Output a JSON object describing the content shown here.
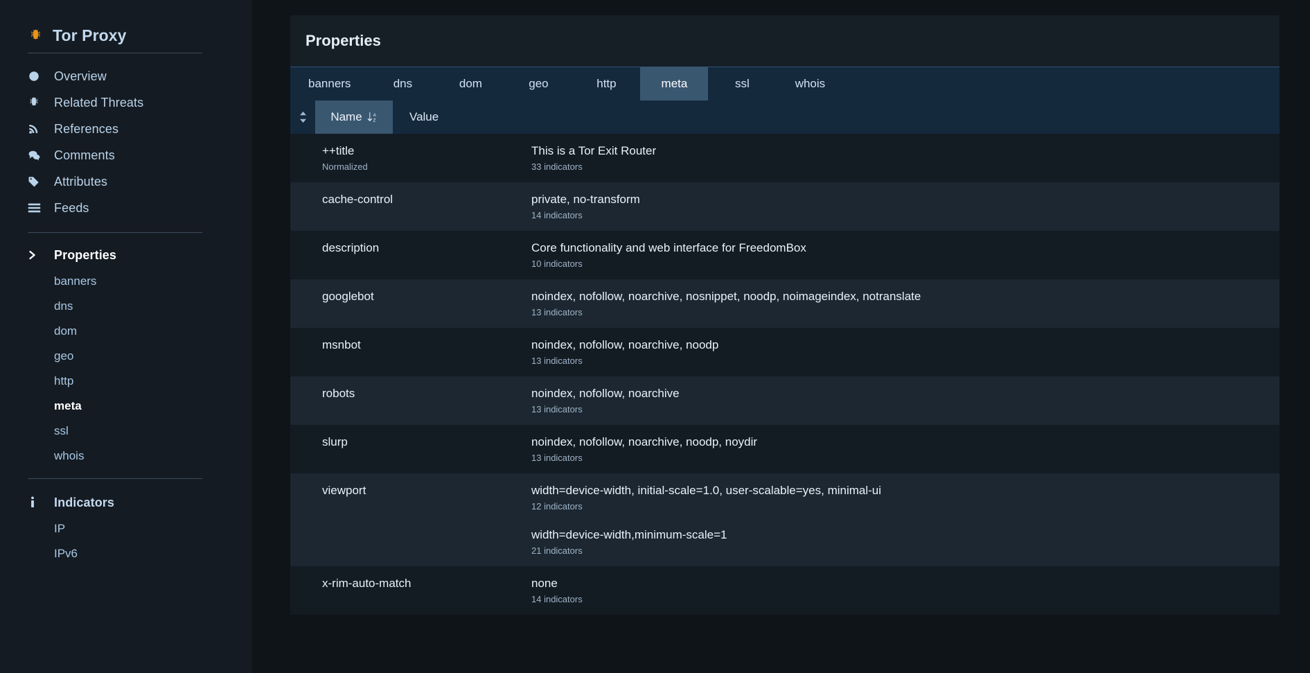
{
  "sidebar": {
    "brand": {
      "icon": "bug-icon",
      "title": "Tor Proxy"
    },
    "nav": [
      {
        "icon": "info-icon",
        "label": "Overview"
      },
      {
        "icon": "bug-icon",
        "label": "Related Threats"
      },
      {
        "icon": "rss-icon",
        "label": "References"
      },
      {
        "icon": "comment-icon",
        "label": "Comments"
      },
      {
        "icon": "tag-icon",
        "label": "Attributes"
      },
      {
        "icon": "list-icon",
        "label": "Feeds"
      }
    ],
    "properties_section": {
      "icon": "chevron-right-icon",
      "label": "Properties",
      "items": [
        {
          "label": "banners",
          "active": false
        },
        {
          "label": "dns",
          "active": false
        },
        {
          "label": "dom",
          "active": false
        },
        {
          "label": "geo",
          "active": false
        },
        {
          "label": "http",
          "active": false
        },
        {
          "label": "meta",
          "active": true
        },
        {
          "label": "ssl",
          "active": false
        },
        {
          "label": "whois",
          "active": false
        }
      ]
    },
    "indicators_section": {
      "icon": "info-icon",
      "label": "Indicators",
      "items": [
        {
          "label": "IP"
        },
        {
          "label": "IPv6"
        }
      ]
    }
  },
  "panel": {
    "title": "Properties",
    "tabs": [
      {
        "label": "banners",
        "active": false
      },
      {
        "label": "dns",
        "active": false
      },
      {
        "label": "dom",
        "active": false
      },
      {
        "label": "geo",
        "active": false
      },
      {
        "label": "http",
        "active": false
      },
      {
        "label": "meta",
        "active": true
      },
      {
        "label": "ssl",
        "active": false
      },
      {
        "label": "whois",
        "active": false
      }
    ],
    "table": {
      "sort_handle_icon": "sort-updown-icon",
      "columns": [
        {
          "label": "Name",
          "sorted": true,
          "sort_icon": "sort-alpha-asc-icon"
        },
        {
          "label": "Value",
          "sorted": false
        }
      ],
      "rows": [
        {
          "name": "++title",
          "name_sub": "Normalized",
          "values": [
            {
              "value": "This is a Tor Exit Router",
              "indicators": "33 indicators"
            }
          ]
        },
        {
          "name": "cache-control",
          "name_sub": "",
          "values": [
            {
              "value": "private, no-transform",
              "indicators": "14 indicators"
            }
          ]
        },
        {
          "name": "description",
          "name_sub": "",
          "values": [
            {
              "value": "Core functionality and web interface for FreedomBox",
              "indicators": "10 indicators"
            }
          ]
        },
        {
          "name": "googlebot",
          "name_sub": "",
          "values": [
            {
              "value": "noindex, nofollow, noarchive, nosnippet, noodp, noimageindex, notranslate",
              "indicators": "13 indicators"
            }
          ]
        },
        {
          "name": "msnbot",
          "name_sub": "",
          "values": [
            {
              "value": "noindex, nofollow, noarchive, noodp",
              "indicators": "13 indicators"
            }
          ]
        },
        {
          "name": "robots",
          "name_sub": "",
          "values": [
            {
              "value": "noindex, nofollow, noarchive",
              "indicators": "13 indicators"
            }
          ]
        },
        {
          "name": "slurp",
          "name_sub": "",
          "values": [
            {
              "value": "noindex, nofollow, noarchive, noodp, noydir",
              "indicators": "13 indicators"
            }
          ]
        },
        {
          "name": "viewport",
          "name_sub": "",
          "values": [
            {
              "value": "width=device-width, initial-scale=1.0, user-scalable=yes, minimal-ui",
              "indicators": "12 indicators"
            },
            {
              "value": "width=device-width,minimum-scale=1",
              "indicators": "21 indicators"
            }
          ]
        },
        {
          "name": "x-rim-auto-match",
          "name_sub": "",
          "values": [
            {
              "value": "none",
              "indicators": "14 indicators"
            }
          ]
        }
      ]
    }
  },
  "colors": {
    "app_bg": "#0f1419",
    "sidebar_bg": "#151b22",
    "panel_bg": "#141c24",
    "tabbar_bg": "#15293d",
    "tab_active_bg": "#3a5770",
    "accent_text": "#b9d3ea",
    "brand_icon": "#e8921c"
  }
}
